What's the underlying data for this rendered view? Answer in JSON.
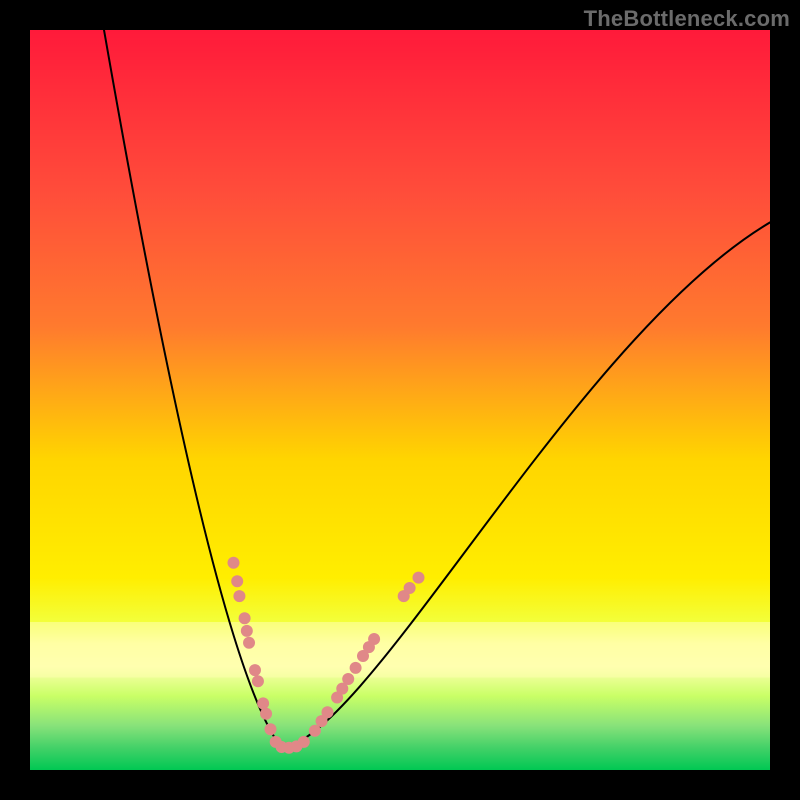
{
  "watermark": "TheBottleneck.com",
  "chart_data": {
    "type": "line",
    "title": "",
    "xlabel": "",
    "ylabel": "",
    "xlim": [
      0,
      100
    ],
    "ylim": [
      0,
      100
    ],
    "grid": false,
    "legend": false,
    "background_gradient": {
      "top_color": "#ff1a3a",
      "upper_mid_color": "#ff7a2e",
      "mid_color": "#ffd500",
      "lower_mid_color": "#f3ff3a",
      "green_band_top": "#c9ff66",
      "green_band_bottom": "#00c853"
    },
    "curve": {
      "type": "v-curve",
      "min_x": 34,
      "min_y": 3,
      "left_top": {
        "x": 10,
        "y": 100
      },
      "right_top": {
        "x": 100,
        "y": 74
      },
      "stroke": "#000000",
      "stroke_width": 2
    },
    "dot_color": "#e08888",
    "dot_radius": 6,
    "dot_clusters": [
      {
        "side": "left",
        "x": 27.5,
        "y": 28.0
      },
      {
        "side": "left",
        "x": 28.0,
        "y": 25.5
      },
      {
        "side": "left",
        "x": 28.3,
        "y": 23.5
      },
      {
        "side": "left",
        "x": 29.0,
        "y": 20.5
      },
      {
        "side": "left",
        "x": 29.3,
        "y": 18.8
      },
      {
        "side": "left",
        "x": 29.6,
        "y": 17.2
      },
      {
        "side": "left",
        "x": 30.4,
        "y": 13.5
      },
      {
        "side": "left",
        "x": 30.8,
        "y": 12.0
      },
      {
        "side": "left",
        "x": 31.5,
        "y": 9.0
      },
      {
        "side": "left",
        "x": 31.9,
        "y": 7.6
      },
      {
        "side": "left",
        "x": 32.5,
        "y": 5.5
      },
      {
        "side": "valley",
        "x": 33.2,
        "y": 3.8
      },
      {
        "side": "valley",
        "x": 34.0,
        "y": 3.1
      },
      {
        "side": "valley",
        "x": 35.0,
        "y": 3.0
      },
      {
        "side": "valley",
        "x": 36.0,
        "y": 3.2
      },
      {
        "side": "valley",
        "x": 37.0,
        "y": 3.8
      },
      {
        "side": "right",
        "x": 38.5,
        "y": 5.3
      },
      {
        "side": "right",
        "x": 39.4,
        "y": 6.6
      },
      {
        "side": "right",
        "x": 40.2,
        "y": 7.8
      },
      {
        "side": "right",
        "x": 41.5,
        "y": 9.8
      },
      {
        "side": "right",
        "x": 42.2,
        "y": 11.0
      },
      {
        "side": "right",
        "x": 43.0,
        "y": 12.3
      },
      {
        "side": "right",
        "x": 44.0,
        "y": 13.8
      },
      {
        "side": "right",
        "x": 45.0,
        "y": 15.4
      },
      {
        "side": "right",
        "x": 45.8,
        "y": 16.6
      },
      {
        "side": "right",
        "x": 46.5,
        "y": 17.7
      },
      {
        "side": "right",
        "x": 50.5,
        "y": 23.5
      },
      {
        "side": "right",
        "x": 51.3,
        "y": 24.6
      },
      {
        "side": "right",
        "x": 52.5,
        "y": 26.0
      }
    ]
  }
}
